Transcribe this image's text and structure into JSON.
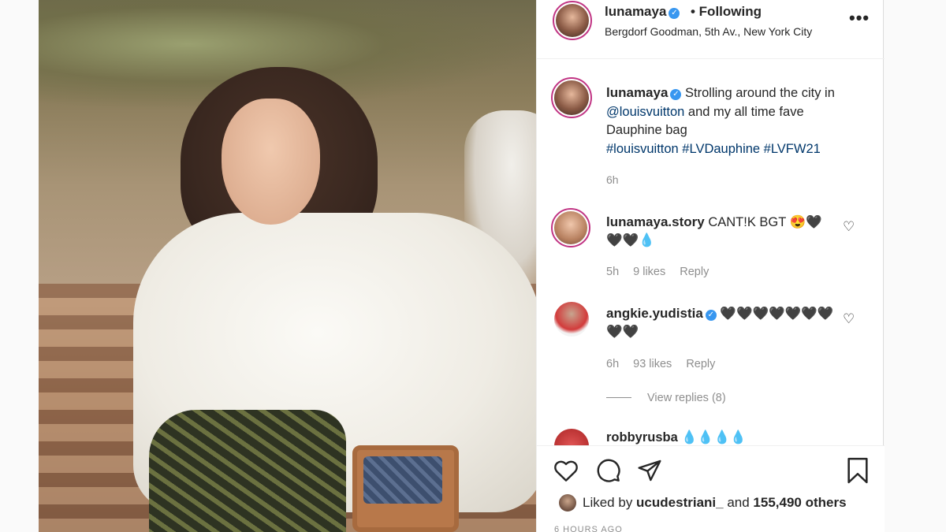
{
  "post": {
    "username": "lunamaya",
    "following_label": "• Following",
    "location": "Bergdorf Goodman, 5th Av., New York City",
    "more_label": "•••",
    "next_arrow": "›"
  },
  "caption": {
    "username": "lunamaya",
    "text_plain": "Strolling around the city in ",
    "mention": "@louisvuitton",
    "text_after": " and my all time fave Dauphine bag",
    "hashtags": "#louisvuitton #LVDauphine #LVFW21",
    "time": "6h"
  },
  "comments": [
    {
      "username": "lunamaya.story",
      "text": "CANT!K BGT 😍🖤🖤🖤💧",
      "time": "5h",
      "likes": "9 likes",
      "reply": "Reply"
    },
    {
      "username": "angkie.yudistia",
      "text": "🖤🖤🖤🖤🖤🖤🖤🖤🖤",
      "time": "6h",
      "likes": "93 likes",
      "reply": "Reply",
      "view_replies": "View replies (8)"
    },
    {
      "username": "robbyrusba",
      "text": "💧💧💧💧"
    }
  ],
  "likes": {
    "prefix": "Liked by ",
    "user": "ucudestriani_",
    "middle": " and ",
    "count": "155,490 others",
    "posted": "6 HOURS AGO"
  },
  "icons": {
    "verified": "verified-check-icon",
    "heart": "heart-icon",
    "comment": "comment-icon",
    "share": "paper-plane-icon",
    "save": "bookmark-icon"
  },
  "colors": {
    "verified": "#3897f0",
    "hashtag": "#00376b",
    "muted": "#8e8e8e"
  }
}
